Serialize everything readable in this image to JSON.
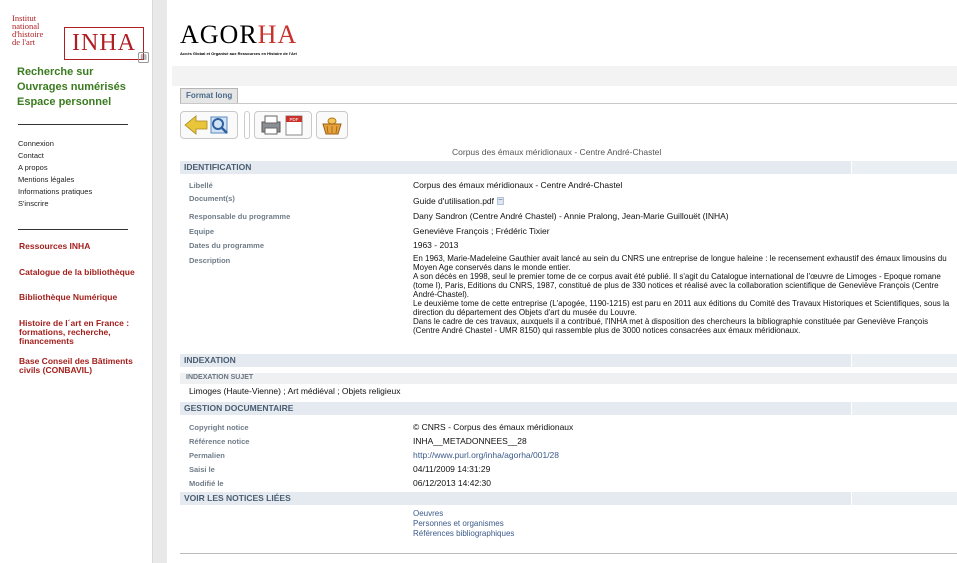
{
  "sidebar": {
    "logo": {
      "lines": [
        "Institut",
        "national",
        "d'histoire",
        "de l'art"
      ],
      "mark": "INHA"
    },
    "green_links": [
      "Recherche sur",
      "Ouvrages numérisés",
      "Espace personnel"
    ],
    "small_links": [
      "Connexion",
      "Contact",
      "A propos",
      "Mentions légales",
      "Informations pratiques",
      "S'inscrire"
    ],
    "red_links": [
      "Ressources INHA",
      "Catalogue de la bibliothèque",
      "Bibliothèque Numérique",
      "Histoire de l´art en France : formations, recherche, financements",
      "Base Conseil des Bâtiments civils (CONBAVIL)"
    ]
  },
  "header": {
    "logo_letters_black": "AGOR",
    "logo_letters_red": "HA",
    "tagline": "Accès Global et Organisé aux Ressources en Histoire de l'Art"
  },
  "tabs": {
    "active": "Format long"
  },
  "record": {
    "title": "Corpus des émaux méridionaux - Centre André-Chastel",
    "identification": {
      "heading": "IDENTIFICATION",
      "rows": [
        {
          "label": "Libellé",
          "value": "Corpus des émaux méridionaux - Centre André-Chastel"
        },
        {
          "label": "Document(s)",
          "value": "Guide d'utilisation.pdf"
        },
        {
          "label": "Responsable du programme",
          "value": "Dany Sandron (Centre André Chastel) - Annie Pralong, Jean-Marie Guillouët (INHA)"
        },
        {
          "label": "Equipe",
          "value": "Geneviève François ; Frédéric Tixier"
        },
        {
          "label": "Dates du programme",
          "value": "1963 - 2013"
        },
        {
          "label": "Description",
          "value": ""
        }
      ],
      "description": [
        "En 1963, Marie-Madeleine Gauthier avait lancé au sein du CNRS une entreprise de longue haleine : le recensement exhaustif des émaux limousins du Moyen Age conservés dans le monde entier.",
        "A son décès en 1998, seul le premier tome de ce corpus avait été publié. Il s'agit du Catalogue international de l'œuvre de Limoges - Epoque romane (tome I), Paris, Editions du CNRS, 1987, constitué de plus de 330 notices et réalisé avec la collaboration scientifique de Geneviève François (Centre André-Chastel).",
        "Le deuxième tome de cette entreprise (L'apogée, 1190-1215) est paru en 2011 aux éditions du Comité des Travaux Historiques et Scientifiques, sous la direction du département des Objets d'art du musée du Louvre.",
        "Dans le cadre de ces travaux, auxquels il a contribué, l'INHA met à disposition des chercheurs la bibliographie constituée par Geneviève François (Centre André Chastel - UMR 8150) qui rassemble plus de 3000 notices consacrées aux émaux méridionaux."
      ]
    },
    "indexation": {
      "heading": "INDEXATION",
      "sub_heading": "INDEXATION SUJET",
      "value": "Limoges (Haute-Vienne) ; Art médiéval ; Objets religieux"
    },
    "gestion": {
      "heading": "GESTION DOCUMENTAIRE",
      "rows": [
        {
          "label": "Copyright notice",
          "value": "© CNRS - Corpus des émaux méridionaux"
        },
        {
          "label": "Référence notice",
          "value": "INHA__METADONNEES__28"
        },
        {
          "label": "Permalien",
          "value": "http://www.purl.org/inha/agorha/001/28"
        },
        {
          "label": "Saisi le",
          "value": "04/11/2009 14:31:29"
        },
        {
          "label": "Modifié le",
          "value": "06/12/2013 14:42:30"
        }
      ]
    },
    "linked": {
      "heading": "VOIR LES NOTICES LIÉES",
      "items": [
        "Oeuvres",
        "Personnes et organismes",
        "Références bibliographiques"
      ]
    }
  },
  "colors": {
    "green": "#3a7b1f",
    "red": "#a3201c",
    "section_bg": "#e4eaf0",
    "label": "#707c88",
    "link": "#3b5a8a"
  },
  "icons": [
    "back-search-icon",
    "print-icon",
    "pdf-export-icon",
    "basket-icon",
    "pdf-file-icon"
  ]
}
